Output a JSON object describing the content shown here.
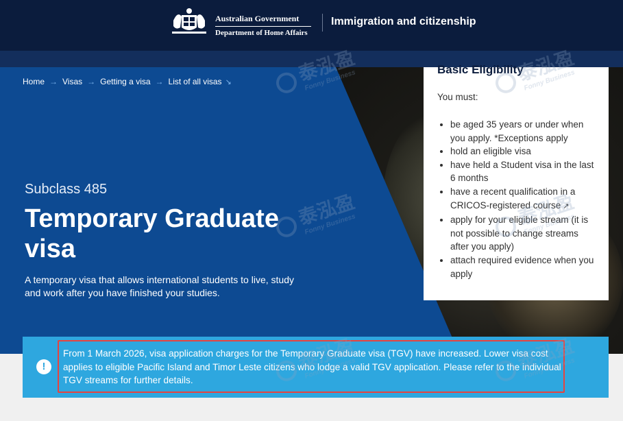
{
  "header": {
    "gov_line1": "Australian Government",
    "gov_line2": "Department of Home Affairs",
    "title": "Immigration and citizenship"
  },
  "breadcrumb": [
    {
      "label": "Home"
    },
    {
      "label": "Visas"
    },
    {
      "label": "Getting a visa"
    },
    {
      "label": "List of all visas"
    }
  ],
  "hero": {
    "subclass": "Subclass 485",
    "title": "Temporary Graduate visa",
    "description": "A temporary visa that allows international students to live, study and work after you have finished your studies."
  },
  "eligibility": {
    "heading": "Basic Eligibility",
    "intro": "You must:",
    "items": [
      "be aged 35 years or under when you apply. *Exceptions apply",
      "hold an eligible visa",
      "have held a Student visa in the last 6 months",
      "have a recent qualification in a CRICOS-registered course",
      "apply for your eligible stream (it is not possible to change streams after you apply)",
      "attach required evidence when you apply"
    ],
    "external_glyph": "↗"
  },
  "alert": {
    "icon": "exclamation-icon",
    "text": "From 1 March 2026, visa application charges for the Temporary Graduate visa (TGV) have increased. Lower visa cost applies to eligible Pacific Island and Timor Leste citizens who lodge a valid TGV application. Please refer to the individual TGV streams for further details."
  },
  "watermark": {
    "text": "泰泓盈",
    "subtext": "Fonny Business"
  },
  "colors": {
    "header_bg": "#0b1c3d",
    "hero_blue": "#0d4a92",
    "alert_bg": "#2ea7df",
    "highlight_border": "#e8433e"
  }
}
